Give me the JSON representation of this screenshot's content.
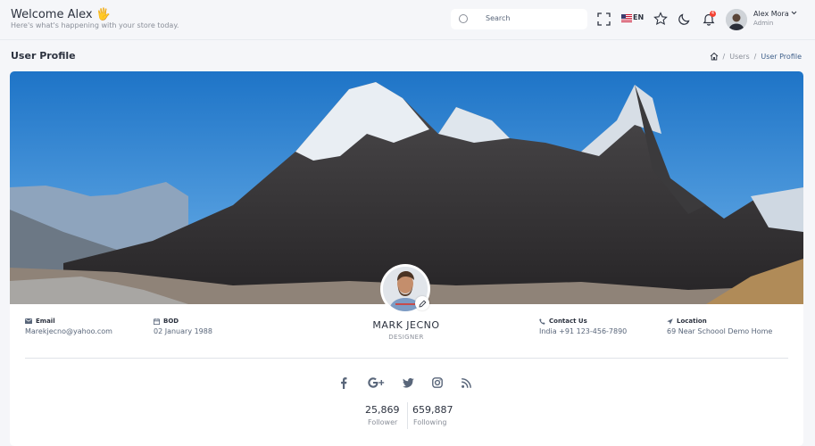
{
  "header": {
    "welcome_title": "Welcome Alex 🖐",
    "welcome_sub": "Here's what's happening with your store today.",
    "search_placeholder": "Search",
    "language": "EN",
    "notification_count": "4",
    "user_name": "Alex Mora",
    "user_role": "Admin"
  },
  "page": {
    "title": "User Profile",
    "breadcrumb": [
      "Users",
      "User Profile"
    ]
  },
  "profile": {
    "name": "MARK JECNO",
    "role": "DESIGNER",
    "email_label": "Email",
    "email": "Marekjecno@yahoo.com",
    "bod_label": "BOD",
    "bod": "02 January 1988",
    "contact_label": "Contact Us",
    "contact": "India +91 123-456-7890",
    "location_label": "Location",
    "location": "69 Near Schoool Demo Home",
    "social": [
      "facebook-icon",
      "google-plus-icon",
      "twitter-icon",
      "instagram-icon",
      "rss-icon"
    ],
    "follower_count": "25,869",
    "follower_label": "Follower",
    "following_count": "659,887",
    "following_label": "Following"
  },
  "colors": {
    "accent": "#3e5f8a",
    "notification": "#f54132",
    "sky_top": "#1e74c7",
    "text_dark": "#2c323f"
  }
}
